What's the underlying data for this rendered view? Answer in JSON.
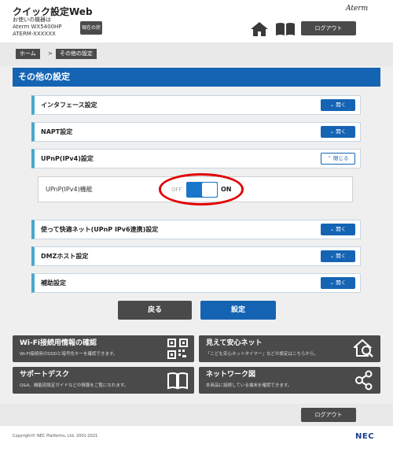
{
  "header": {
    "app_title": "クイック設定Web",
    "device_label": "お使いの機器は",
    "device_model": "Aterm WX5400HP",
    "device_id": "ATERM-XXXXXX",
    "status_button": "現在の状態",
    "brand": "Aterm",
    "logout": "ログアウト",
    "home_icon": "home-icon",
    "manual_icon": "book-icon"
  },
  "breadcrumb": {
    "home": "ホーム",
    "separator": ">",
    "current": "その他の設定"
  },
  "page": {
    "title": "その他の設定",
    "accent_color": "#1564b4"
  },
  "sections": [
    {
      "title": "インタフェース設定",
      "button": "開く",
      "expanded": false
    },
    {
      "title": "NAPT設定",
      "button": "開く",
      "expanded": false
    },
    {
      "title": "UPnP(IPv4)設定",
      "button": "閉じる",
      "expanded": true
    },
    {
      "title": "使って快適ネット(UPnP IPv6連携)設定",
      "button": "開く",
      "expanded": false
    },
    {
      "title": "DMZホスト設定",
      "button": "開く",
      "expanded": false
    },
    {
      "title": "補助設定",
      "button": "開く",
      "expanded": false
    }
  ],
  "upnp": {
    "label": "UPnP(IPv4)機能",
    "off_text": "OFF",
    "on_text": "ON",
    "state": "ON"
  },
  "actions": {
    "back": "戻る",
    "apply": "設定"
  },
  "tiles": [
    {
      "title": "Wi-Fi接続用情報の確認",
      "desc": "Wi-Fi接続用のSSIDと暗号化キーを確認できます。",
      "icon": "qr-code-icon"
    },
    {
      "title": "見えて安心ネット",
      "desc": "「こども安心ネットタイマー」などの設定はこちらから。",
      "icon": "home-search-icon"
    },
    {
      "title": "サポートデスク",
      "desc": "Q&A、機能別設定ガイドなどの情報をご覧になれます。",
      "icon": "book-icon"
    },
    {
      "title": "ネットワーク図",
      "desc": "本商品に接続している端末を確認できます。",
      "icon": "network-icon"
    }
  ],
  "footer": {
    "logout": "ログアウト",
    "copyright": "Copyright© NEC Platforms, Ltd. 2001-2021",
    "logo": "NEC"
  }
}
